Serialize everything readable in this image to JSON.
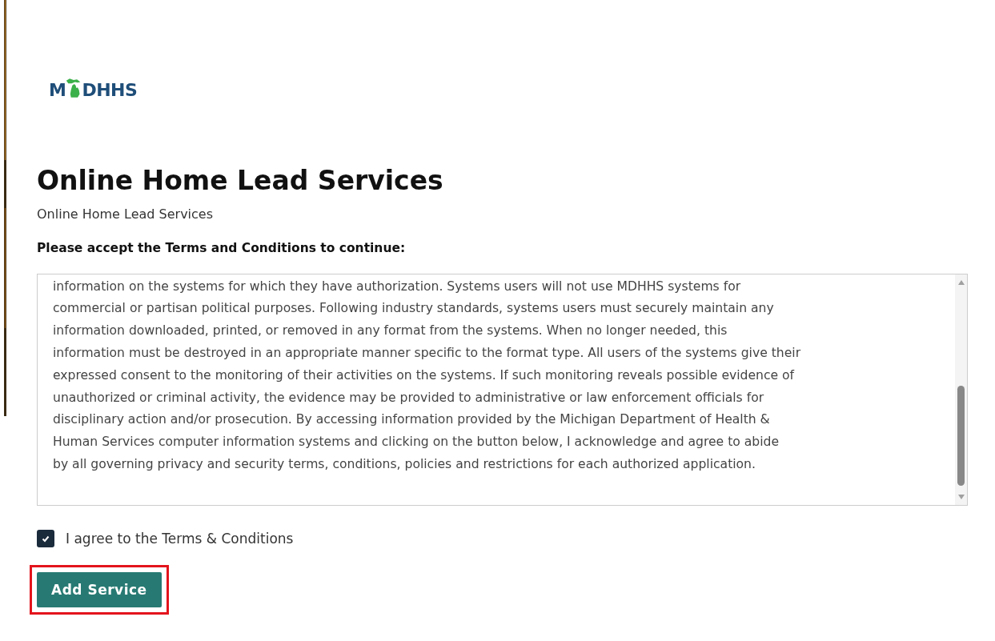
{
  "logo": {
    "letter": "M",
    "rest": "DHHS"
  },
  "title": "Online Home Lead Services",
  "subtitle": "Online Home Lead Services",
  "prompt": "Please accept the Terms and Conditions to continue:",
  "terms": {
    "lines": [
      "information on the systems for which they have authorization. Systems users will not use MDHHS systems for",
      "commercial or partisan political purposes. Following industry standards, systems users must securely maintain any",
      "information downloaded, printed, or removed in any format from the systems. When no longer needed, this",
      "information must be destroyed in an appropriate manner specific to the format type. All users of the systems give their",
      "expressed consent to the monitoring of their activities on the systems. If such monitoring reveals possible evidence of",
      "unauthorized or criminal activity, the evidence may be provided to administrative or law enforcement officials for",
      "disciplinary action and/or prosecution. By accessing information provided by the Michigan Department of Health &",
      "Human Services computer information systems and clicking on the button below, I acknowledge and agree to abide",
      "by all governing privacy and security terms, conditions, policies and restrictions for each authorized application."
    ]
  },
  "agree": {
    "label": "I agree to the Terms & Conditions",
    "checked": true
  },
  "button": {
    "label": "Add Service",
    "highlighted": true
  }
}
